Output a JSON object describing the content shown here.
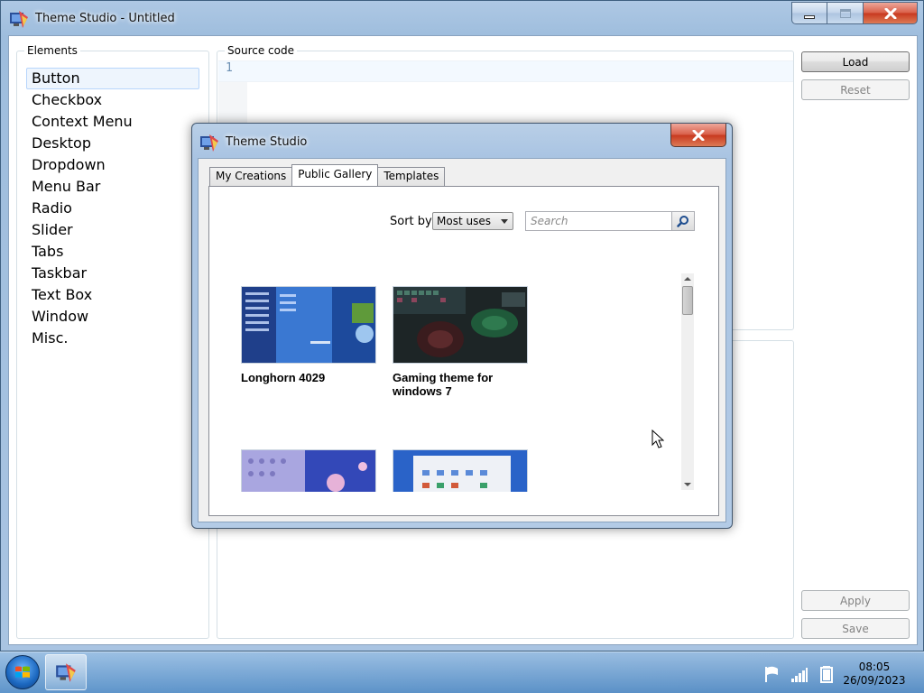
{
  "window": {
    "title": "Theme Studio - Untitled",
    "icon": "theme-studio-app-icon",
    "caption_icons": [
      "minimize-icon",
      "maximize-icon",
      "close-icon"
    ]
  },
  "elements_panel": {
    "label": "Elements",
    "items": [
      "Button",
      "Checkbox",
      "Context Menu",
      "Desktop",
      "Dropdown",
      "Menu Bar",
      "Radio",
      "Slider",
      "Tabs",
      "Taskbar",
      "Text Box",
      "Window",
      "Misc."
    ],
    "selected": "Button"
  },
  "source_panel": {
    "label": "Source code",
    "line_number": "1"
  },
  "side_buttons": {
    "load": "Load",
    "reset": "Reset",
    "apply": "Apply",
    "save": "Save"
  },
  "dialog": {
    "title": "Theme Studio",
    "tabs": [
      "My Creations",
      "Public Gallery",
      "Templates"
    ],
    "active_tab": "Public Gallery",
    "sort_label": "Sort by",
    "sort_value": "Most uses",
    "search_placeholder": "Search",
    "gallery": [
      {
        "title": "Longhorn 4029",
        "thumb": "longhorn-start-menu-screenshot"
      },
      {
        "title": "Gaming theme for windows 7",
        "thumb": "gaming-keyboard-controller-photo"
      },
      {
        "title": "",
        "thumb": "blue-purple-desktop-screenshot"
      },
      {
        "title": "",
        "thumb": "light-blue-start-menu-screenshot"
      }
    ]
  },
  "taskbar": {
    "clock_time": "08:05",
    "clock_date": "26/09/2023",
    "tray_icons": [
      "action-center-flag-icon",
      "network-signal-icon",
      "battery-icon"
    ]
  },
  "colors": {
    "accent_selection": "#b8d6fb",
    "close_red": "#c8391f",
    "window_frame": "#a9c4e2"
  }
}
